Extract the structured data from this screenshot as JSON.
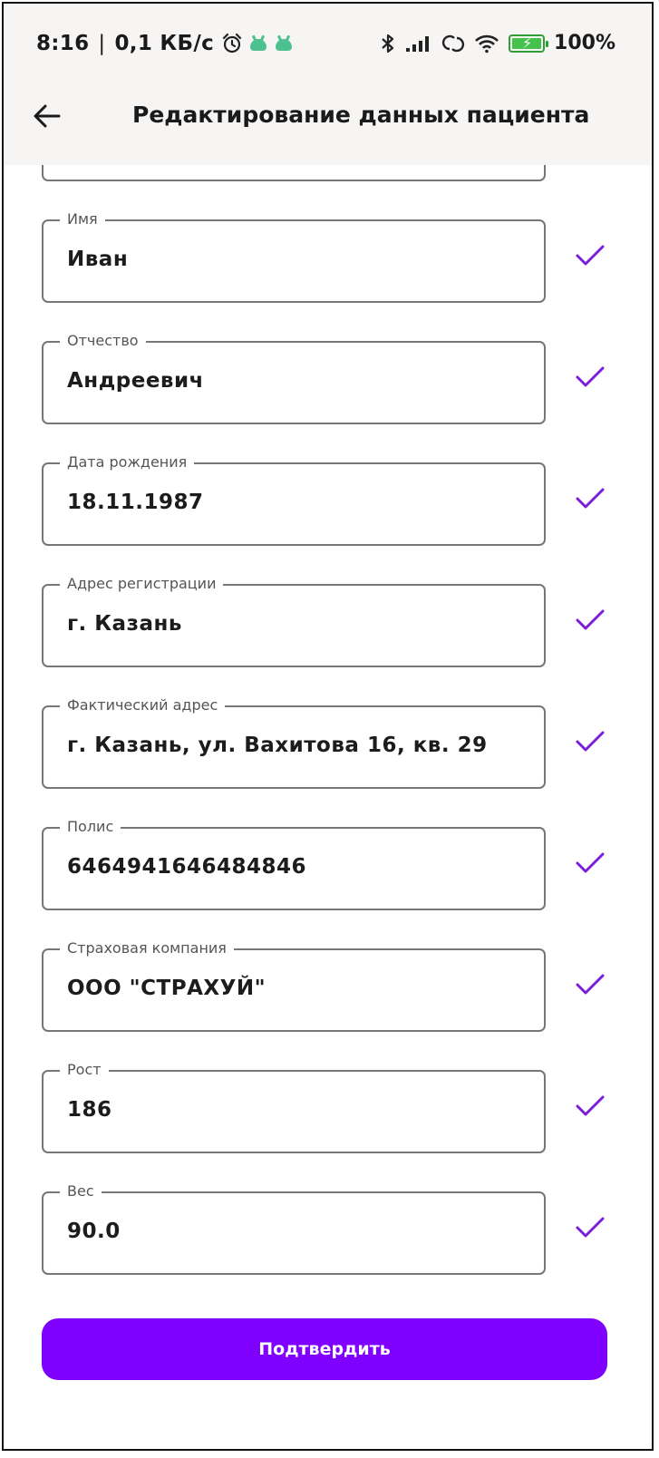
{
  "status_bar": {
    "time": "8:16",
    "separator": "|",
    "network_speed": "0,1 КБ/с",
    "battery": "100%",
    "icons": [
      "alarm-icon",
      "android-bot-icon",
      "android-bot-icon",
      "bluetooth-icon",
      "signal-icon",
      "hotspot-icon",
      "wifi-icon",
      "battery-charging-icon"
    ]
  },
  "header": {
    "title": "Редактирование данных пациента",
    "back_icon": "arrow-left-icon"
  },
  "fields": [
    {
      "label": "Имя",
      "value": "Иван"
    },
    {
      "label": "Отчество",
      "value": "Андреевич"
    },
    {
      "label": "Дата рождения",
      "value": "18.11.1987"
    },
    {
      "label": "Адрес регистрации",
      "value": "г. Казань"
    },
    {
      "label": "Фактический адрес",
      "value": "г. Казань, ул. Вахитова 16, кв. 29"
    },
    {
      "label": "Полис",
      "value": "6464941646484846"
    },
    {
      "label": "Страховая компания",
      "value": "ООО \"СТРАХУЙ\""
    },
    {
      "label": "Рост",
      "value": "186"
    },
    {
      "label": "Вес",
      "value": "90.0"
    }
  ],
  "submit_label": "Подтвердить",
  "colors": {
    "accent": "#7f00ff",
    "check": "#7a1fd9",
    "field_border": "#767676",
    "header_bg": "#f7f4f4"
  }
}
